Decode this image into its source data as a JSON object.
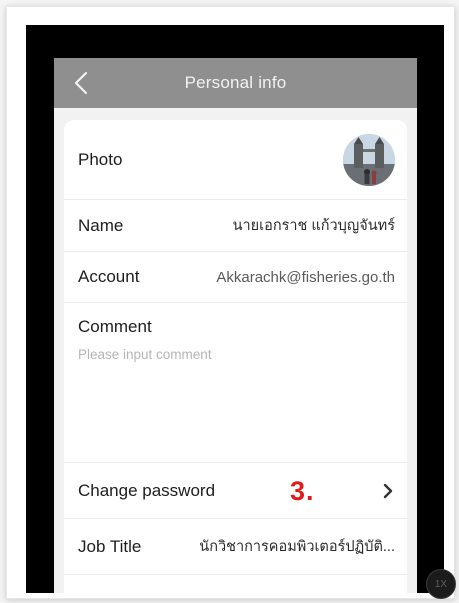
{
  "header": {
    "title": "Personal info",
    "back_icon": "chevron-left-icon"
  },
  "rows": {
    "photo": {
      "label": "Photo"
    },
    "name": {
      "label": "Name",
      "value": "นายเอกราช แก้วบุญจันทร์"
    },
    "account": {
      "label": "Account",
      "value": "Akkarachk@fisheries.go.th"
    },
    "comment": {
      "label": "Comment",
      "placeholder": "Please input comment",
      "value": ""
    },
    "change_password": {
      "label": "Change password",
      "chevron_icon": "chevron-right-icon"
    },
    "job_title": {
      "label": "Job Title",
      "value": "นักวิชาการคอมพิวเตอร์ปฏิบัติ..."
    }
  },
  "annotation": {
    "step_label": "3."
  },
  "zoom_badge": {
    "label": "1X"
  },
  "colors": {
    "navbar": "#8f8f8f",
    "step_mark": "#e11b1b",
    "screen_bg": "#f2f2f2"
  }
}
